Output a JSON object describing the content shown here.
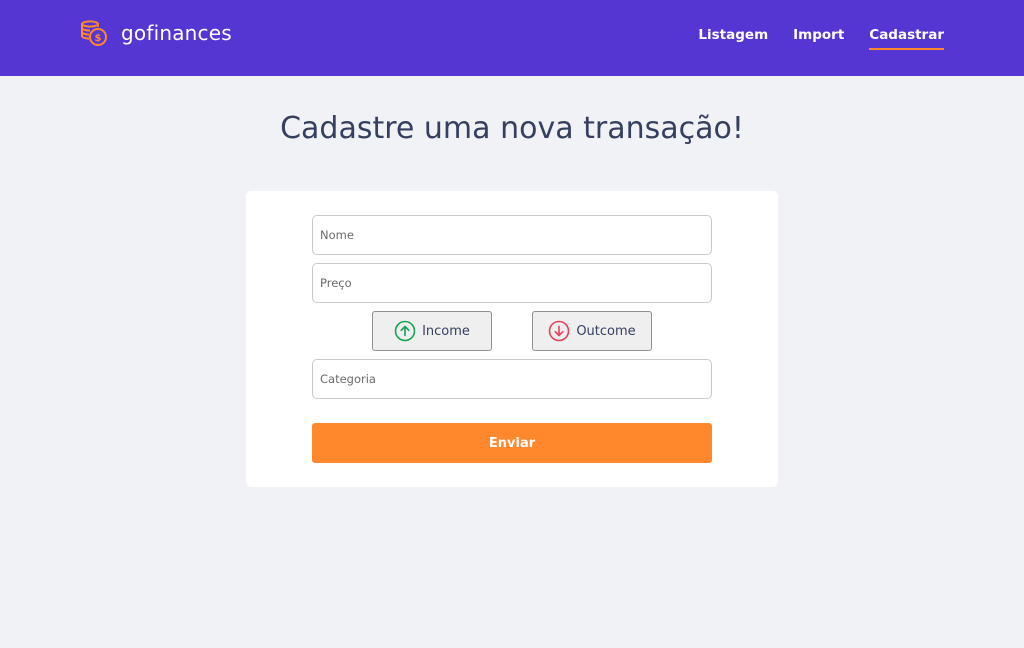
{
  "header": {
    "brand_name": "gofinances",
    "brand_icon": "coins-dollar-icon",
    "nav": [
      {
        "label": "Listagem",
        "active": false
      },
      {
        "label": "Import",
        "active": false
      },
      {
        "label": "Cadastrar",
        "active": true
      }
    ]
  },
  "main": {
    "title": "Cadastre uma nova transação!"
  },
  "form": {
    "name_placeholder": "Nome",
    "price_placeholder": "Preço",
    "category_placeholder": "Categoria",
    "income": {
      "label": "Income",
      "icon": "arrow-up-circle-icon"
    },
    "outcome": {
      "label": "Outcome",
      "icon": "arrow-down-circle-icon"
    },
    "submit_label": "Enviar"
  },
  "colors": {
    "header_bg": "#5636d3",
    "accent": "#ff872c",
    "income": "#12a454",
    "outcome": "#e83f5b",
    "page_bg": "#f0f2f5",
    "title_text": "#363f5f"
  }
}
